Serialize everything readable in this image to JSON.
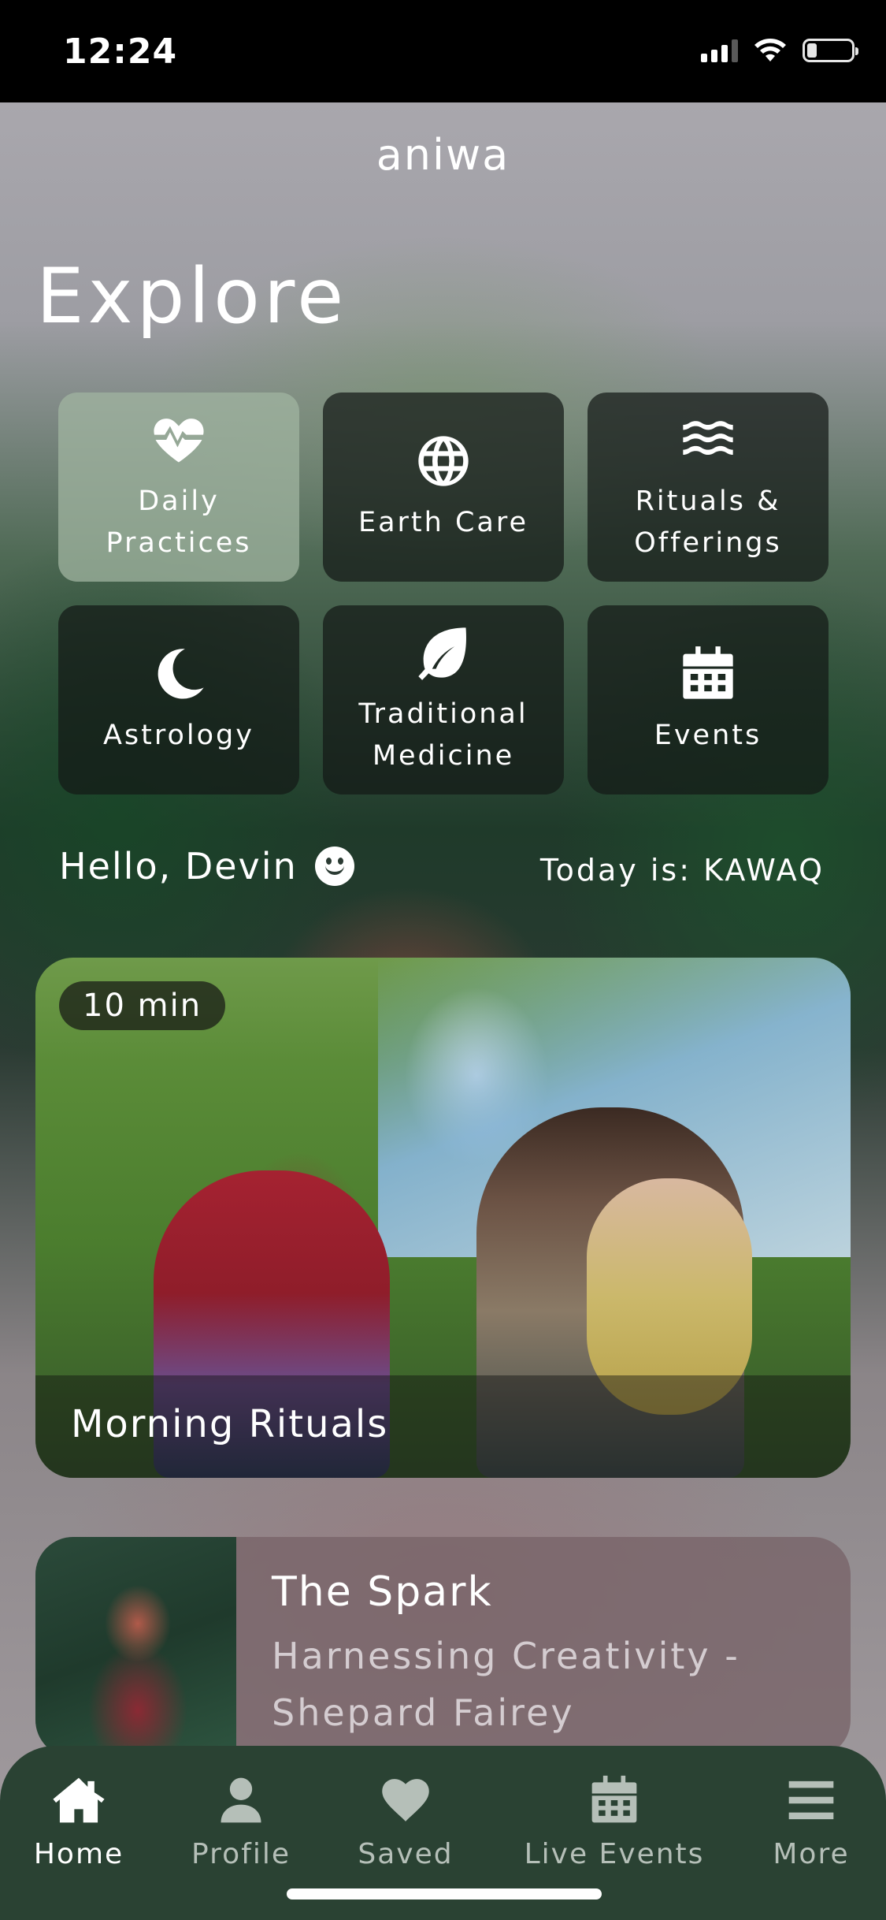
{
  "status_bar": {
    "time": "12:24"
  },
  "header": {
    "app_name": "aniwa",
    "title": "Explore"
  },
  "categories": [
    {
      "label": "Daily\nPractices",
      "icon": "heart-pulse-icon",
      "active": true
    },
    {
      "label": "Earth Care",
      "icon": "globe-icon",
      "active": false
    },
    {
      "label": "Rituals &\nOfferings",
      "icon": "waves-icon",
      "active": false
    },
    {
      "label": "Astrology",
      "icon": "moon-icon",
      "active": false
    },
    {
      "label": "Traditional\nMedicine",
      "icon": "leaf-icon",
      "active": false
    },
    {
      "label": "Events",
      "icon": "calendar-icon",
      "active": false
    }
  ],
  "greeting": {
    "text": "Hello, Devin",
    "today": "Today is: KAWAQ"
  },
  "featured": {
    "duration": "10 min",
    "title": "Morning Rituals"
  },
  "list_item": {
    "title": "The Spark",
    "subtitle": "Harnessing Creativity -\nShepard Fairey"
  },
  "tabbar": {
    "items": [
      {
        "label": "Home",
        "icon": "home-icon",
        "active": true
      },
      {
        "label": "Profile",
        "icon": "user-icon",
        "active": false
      },
      {
        "label": "Saved",
        "icon": "heart-icon",
        "active": false
      },
      {
        "label": "Live Events",
        "icon": "calendar-icon",
        "active": false
      },
      {
        "label": "More",
        "icon": "menu-icon",
        "active": false
      }
    ]
  },
  "colors": {
    "tabbar_bg": "#2a4233",
    "active_tile": "#a0b4a0"
  }
}
